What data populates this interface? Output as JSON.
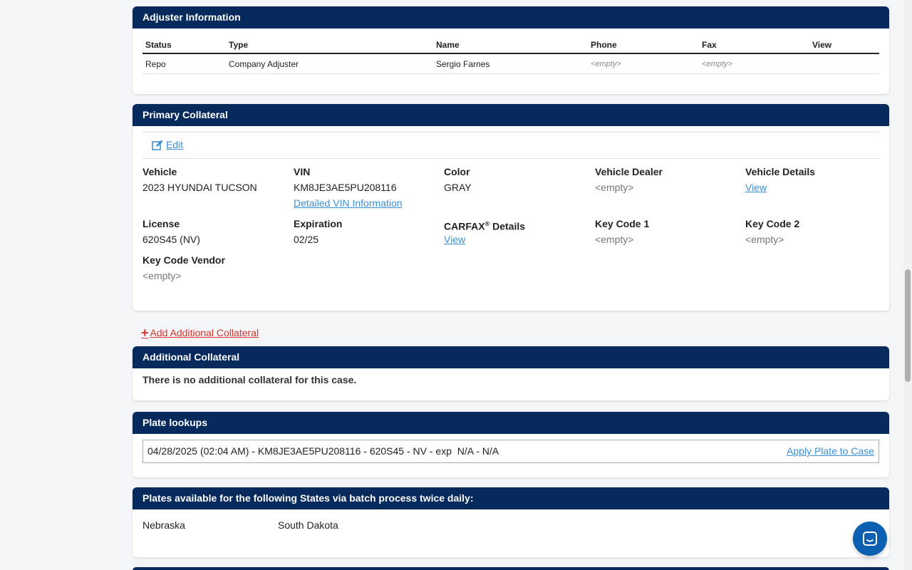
{
  "adjuster": {
    "title": "Adjuster Information",
    "headers": [
      "Status",
      "Type",
      "Name",
      "Phone",
      "Fax",
      "View"
    ],
    "row": {
      "status": "Repo",
      "type": "Company Adjuster",
      "name": "Sergio Farnes",
      "phone": "<empty>",
      "fax": "<empty>"
    }
  },
  "primary": {
    "title": "Primary Collateral",
    "edit": "Edit",
    "vehicle_label": "Vehicle",
    "vehicle": "2023 HYUNDAI TUCSON",
    "vin_label": "VIN",
    "vin": "KM8JE3AE5PU208116",
    "vin_link": "Detailed VIN Information",
    "color_label": "Color",
    "color": "GRAY",
    "dealer_label": "Vehicle Dealer",
    "dealer": "<empty>",
    "details_label": "Vehicle Details",
    "details_link": "View",
    "license_label": "License",
    "license": "620S45 (NV)",
    "expiration_label": "Expiration",
    "expiration": "02/25",
    "carfax_label": "CARFAX",
    "carfax_reg": "®",
    "carfax_suffix": " Details",
    "carfax_link": "View",
    "key1_label": "Key Code 1",
    "key1": "<empty>",
    "key2_label": "Key Code 2",
    "key2": "<empty>",
    "vendor_label": "Key Code Vendor",
    "vendor": "<empty>"
  },
  "add_collateral": "Add Additional Collateral",
  "additional": {
    "title": "Additional Collateral",
    "message": "There is no additional collateral for this case."
  },
  "plates": {
    "title": "Plate lookups",
    "entry": "04/28/2025 (02:04 AM) - KM8JE3AE5PU208116 - 620S45 - NV - exp  N/A - N/A",
    "apply": "Apply Plate to Case"
  },
  "batch": {
    "title": "Plates available for the following States via batch process twice daily:",
    "states": [
      "Nebraska",
      "South Dakota"
    ]
  },
  "colors": {
    "header": "#072a5c",
    "link": "#3b8fd6",
    "add_link": "#d9342b",
    "chat": "#0a5fb0"
  }
}
